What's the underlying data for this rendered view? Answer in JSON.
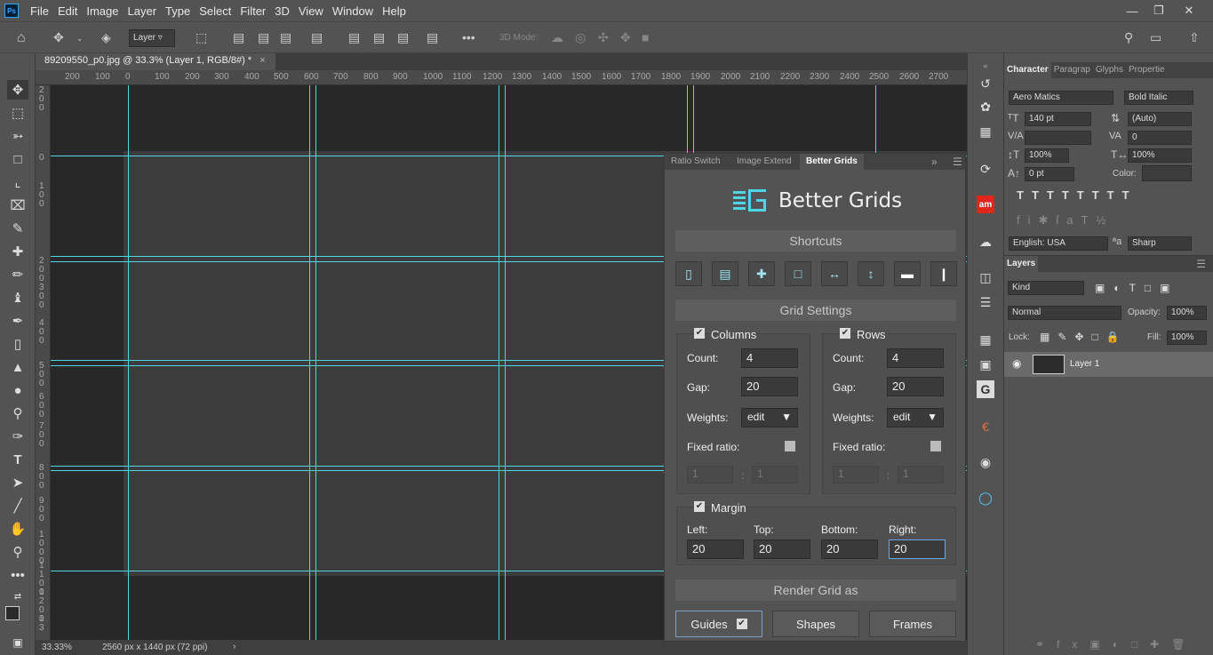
{
  "app": {
    "logo": "Ps",
    "menu": [
      "File",
      "Edit",
      "Image",
      "Layer",
      "Type",
      "Select",
      "Filter",
      "3D",
      "View",
      "Window",
      "Help"
    ]
  },
  "options": {
    "auto_select": "Layer",
    "mode_3d": "3D Mode:"
  },
  "document": {
    "tab": "89209550_p0.jpg @ 33.3% (Layer 1, RGB/8#) *",
    "zoom": "33.33%",
    "info": "2560 px x 1440 px (72 ppi)"
  },
  "ruler": {
    "h": [
      "200",
      "100",
      "0",
      "100",
      "200",
      "300",
      "400",
      "500",
      "600",
      "700",
      "800",
      "900",
      "1000",
      "1100",
      "1200",
      "1300",
      "1400",
      "1500",
      "1600",
      "1700",
      "1800",
      "1900",
      "2000",
      "2100",
      "2200",
      "2300",
      "2400",
      "2500",
      "2600",
      "2700"
    ],
    "v": [
      [
        "2",
        "0",
        "0"
      ],
      [
        "0"
      ],
      [
        "1",
        "0",
        "0"
      ],
      [
        "2",
        "0",
        "0"
      ],
      [
        "3",
        "0",
        "0"
      ],
      [
        "4",
        "0",
        "0"
      ],
      [
        "5",
        "0",
        "0"
      ],
      [
        "6",
        "0",
        "0"
      ],
      [
        "7",
        "0",
        "0"
      ],
      [
        "8",
        "0",
        "0"
      ],
      [
        "9",
        "0",
        "0"
      ],
      [
        "1",
        "0",
        "0",
        "0"
      ],
      [
        "1",
        "1",
        "0",
        "0"
      ],
      [
        "1",
        "2",
        "0",
        "0"
      ],
      [
        "1",
        "3",
        "0",
        "0"
      ],
      [
        "1",
        "4",
        "0",
        "0"
      ]
    ]
  },
  "character": {
    "tabs": [
      "Character",
      "Paragrap",
      "Glyphs",
      "Propertie"
    ],
    "font": "Aero Matics",
    "style": "Bold Italic",
    "size": "140 pt",
    "leading": "(Auto)",
    "tracking": "0",
    "vscale": "100%",
    "hscale": "100%",
    "baseline": "0 pt",
    "color_label": "Color:",
    "language": "English: USA",
    "aa": "Sharp"
  },
  "layers": {
    "title": "Layers",
    "kind": "Kind",
    "blend": "Normal",
    "opacity_label": "Opacity:",
    "opacity": "100%",
    "lock_label": "Lock:",
    "fill_label": "Fill:",
    "fill": "100%",
    "layer_name": "Layer 1"
  },
  "better_grids": {
    "tabs": [
      "Ratio Switch",
      "Image Extend",
      "Better Grids"
    ],
    "title": "Better Grids",
    "shortcuts": "Shortcuts",
    "grid_settings": "Grid Settings",
    "columns": {
      "label": "Columns",
      "count_label": "Count:",
      "count": "4",
      "gap_label": "Gap:",
      "gap": "20",
      "weights_label": "Weights:",
      "weights": "edit",
      "fixed_label": "Fixed ratio:",
      "r1": "1",
      "r2": "1",
      "sep": ":"
    },
    "rows": {
      "label": "Rows",
      "count_label": "Count:",
      "count": "4",
      "gap_label": "Gap:",
      "gap": "20",
      "weights_label": "Weights:",
      "weights": "edit",
      "fixed_label": "Fixed ratio:",
      "r1": "1",
      "r2": "1",
      "sep": ":"
    },
    "margin": {
      "label": "Margin",
      "left_label": "Left:",
      "left": "20",
      "top_label": "Top:",
      "top": "20",
      "bottom_label": "Bottom:",
      "bottom": "20",
      "right_label": "Right:",
      "right": "20"
    },
    "render_label": "Render Grid as",
    "render": [
      "Guides",
      "Shapes",
      "Frames"
    ]
  },
  "colors": {
    "guide": "#4fd6e6",
    "accent": "#31a8ff"
  }
}
